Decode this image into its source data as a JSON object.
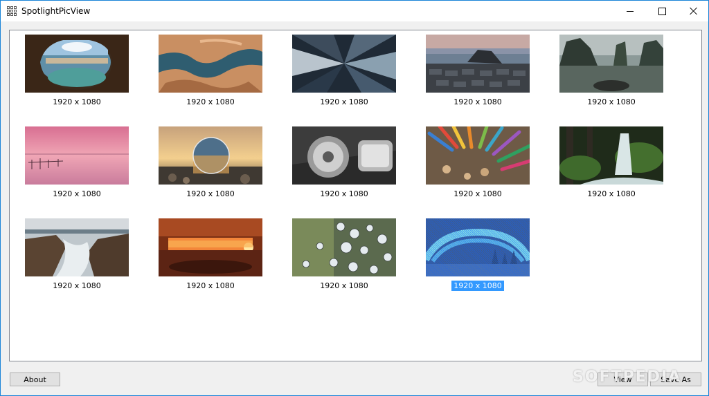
{
  "window": {
    "title": "SpotlightPicView"
  },
  "thumbnails": [
    {
      "caption": "1920 x 1080"
    },
    {
      "caption": "1920 x 1080"
    },
    {
      "caption": "1920 x 1080"
    },
    {
      "caption": "1920 x 1080"
    },
    {
      "caption": "1920 x 1080"
    },
    {
      "caption": "1920 x 1080"
    },
    {
      "caption": "1920 x 1080"
    },
    {
      "caption": "1920 x 1080"
    },
    {
      "caption": "1920 x 1080"
    },
    {
      "caption": "1920 x 1080"
    },
    {
      "caption": "1920 x 1080"
    },
    {
      "caption": "1920 x 1080"
    },
    {
      "caption": "1920 x 1080"
    },
    {
      "caption": "1920 x 1080",
      "selected": true
    }
  ],
  "buttons": {
    "about": "About",
    "view": "View",
    "save_as": "Save As"
  },
  "watermark": "SOFTPEDIA",
  "colors": {
    "selection": "#3399ff",
    "window_border": "#1883d7"
  }
}
